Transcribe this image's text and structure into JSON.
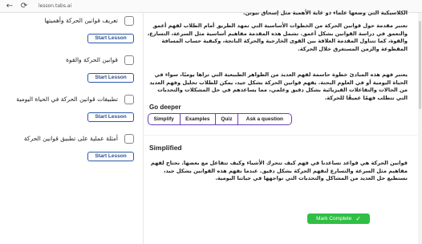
{
  "browser": {
    "back_icon": "arrow-left",
    "reload_icon": "reload",
    "url": "lesson.tabs.ai"
  },
  "sidebar": {
    "lessons": [
      {
        "title": "تعريف قوانين الحركة وأهميتها",
        "button": "Start Lesson"
      },
      {
        "title": "قوانين الحركة والقوة",
        "button": "Start Lesson"
      },
      {
        "title": "تطبيقات قوانين الحركة في الحياة اليومية",
        "button": "Start Lesson"
      },
      {
        "title": "أمثلة عملية على تطبيق قوانين الحركة",
        "button": "Start Lesson"
      }
    ]
  },
  "content": {
    "intro_partial": "الكلاسيكية التي وضعها علماء ذو غاية الأهمية مثل إسحاق نيوتن.",
    "paragraph_1": "تعتبر مقدمة حول قوانين الحركة من الخطوات الأساسية التي تمهد الطريق أمام الطلاب لفهم أعمق والتعمق في دراسة القوانين بشكل أعمق. تشمل هذه المقدمة مفاهيم أساسية مثل السرعة، التسارع، والقوة، كما تتناول المقدمة العلاقة بين القوى الخارجية والحركة الناتجة، وكيفية حساب المسافة المقطوعة والزمن المستغرق خلال الحركة.",
    "paragraph_2": "يعتبر فهم هذه المبادئ خطوة حاسمة لفهم العديد من الظواهر الطبيعية التي تراها يوميًا، سواء في الحياة اليومية أو في العلوم البحتة. يفهم قوانين الحركة بشكل جيد، يمكن للطلاب تحليل وفهم العديد من الحالات والتفاعلات الفيزيائية بشكل دقيق وعلمي، مما يساعدهم في حل المشكلات والتحديات التي تتطلب فهمًا عميقًا للحركة.",
    "go_deeper_label": "Go deeper",
    "tabs": [
      "Simplify",
      "Examples",
      "Quiz",
      "Ask a question"
    ],
    "simplified_title": "Simplified",
    "simplified_text": "قوانين الحركة هي قواعد تساعدنا في فهم كيف تتحرك الأشياء وكيف تتفاعل مع بعضها. نحتاج لفهم مفاهيم مثل السرعة والتسارع لنفهم الحركة بشكل دقيق. عندما نفهم هذه القوانين بشكل جيد، نستطيع حل العديد من المشاكل والتحديات التي نواجهها في حياتنا اليومية.",
    "complete_button": "Mark Complete",
    "complete_icon": "check-icon"
  }
}
